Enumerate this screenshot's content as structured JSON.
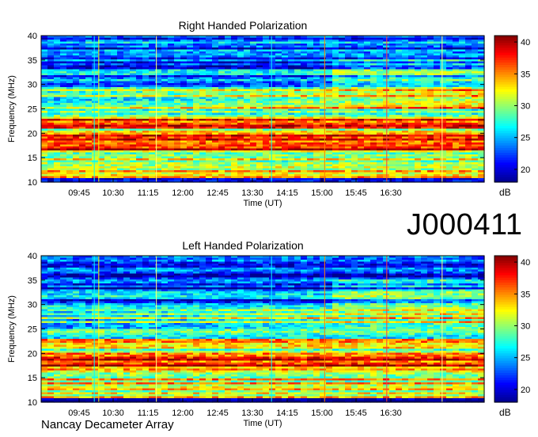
{
  "date_label": "J000411",
  "footer": "Nancay Decameter Array",
  "colormap": [
    "#00008f",
    "#0000ff",
    "#0080ff",
    "#00ffff",
    "#80ff80",
    "#ffff00",
    "#ff8000",
    "#ff0000",
    "#800000"
  ],
  "chart_data": [
    {
      "type": "heatmap",
      "title": "Right Handed Polarization",
      "xlabel": "Time (UT)",
      "ylabel": "Frequency (MHz)",
      "x_tick_labels": [
        "09:45",
        "10:30",
        "11:15",
        "12:00",
        "12:45",
        "13:30",
        "14:15",
        "15:00",
        "15:45",
        "16:30"
      ],
      "y_ticks": [
        10,
        15,
        20,
        25,
        30,
        35,
        40
      ],
      "ylim": [
        10,
        40
      ],
      "colorbar": {
        "label": "dB",
        "ticks": [
          20,
          25,
          30,
          35,
          40
        ],
        "range": [
          18,
          41
        ]
      }
    },
    {
      "type": "heatmap",
      "title": "Left Handed Polarization",
      "xlabel": "Time (UT)",
      "ylabel": "Frequency (MHz)",
      "x_tick_labels": [
        "09:45",
        "10:30",
        "11:15",
        "12:00",
        "12:45",
        "13:30",
        "14:15",
        "15:00",
        "15:45",
        "16:30"
      ],
      "y_ticks": [
        10,
        15,
        20,
        25,
        30,
        35,
        40
      ],
      "ylim": [
        10,
        40
      ],
      "colorbar": {
        "label": "dB",
        "ticks": [
          20,
          25,
          30,
          35,
          40
        ],
        "range": [
          18,
          41
        ]
      }
    }
  ]
}
